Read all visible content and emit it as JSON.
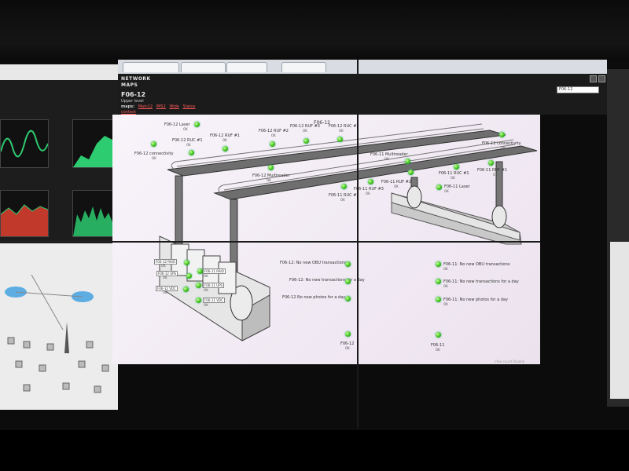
{
  "app": {
    "nav1": "NETWORK",
    "nav2": "MAPS",
    "title": "F06-12",
    "level": "Upper level",
    "maps_label": "maps:",
    "map_links": [
      "Main12",
      "IMS2",
      "Wide",
      "Status"
    ],
    "extra_link": "context",
    "search_value": "F06-12"
  },
  "map": {
    "header": "F06-12",
    "footer": "View count  Disable",
    "gantry_left": [
      {
        "label": "F06-12 Laser",
        "status": "OK"
      },
      {
        "label": "F06-12 RUC #1",
        "status": "OK"
      },
      {
        "label": "F06-12 RUF #1",
        "status": "OK"
      },
      {
        "label": "F06-12 RUF #2",
        "status": "OK"
      },
      {
        "label": "F06-12 RUF #3",
        "status": "OK"
      },
      {
        "label": "F06-12 RUC #2",
        "status": "OK"
      },
      {
        "label": "F06-12 connectivity",
        "status": "OK"
      },
      {
        "label": "F06-12 Multireader",
        "status": "OK"
      }
    ],
    "gantry_right": [
      {
        "label": "F06-11 connectivity",
        "status": "OK"
      },
      {
        "label": "F06-11 Multireader",
        "status": "OK"
      },
      {
        "label": "F06-11 RUF #1",
        "status": "OK"
      },
      {
        "label": "F06-11 RUC #1",
        "status": "OK"
      },
      {
        "label": "F06-11 RUF #2",
        "status": "OK"
      },
      {
        "label": "F06-11 RUF #3",
        "status": "OK"
      },
      {
        "label": "F06-11 RUC #2",
        "status": "OK"
      },
      {
        "label": "F06-11 Laser",
        "status": "OK"
      }
    ],
    "cabinet": [
      {
        "label": "F06-12 RAIO",
        "status": "OK"
      },
      {
        "label": "F06-12 UPS",
        "status": "OK"
      },
      {
        "label": "F06-11 RAIO",
        "status": "OK"
      },
      {
        "label": "F06-12 VDC",
        "status": "OK"
      },
      {
        "label": "F06-11 UPS",
        "status": "OK"
      },
      {
        "label": "F06-11 VDC",
        "status": "OK"
      }
    ],
    "checks_12": [
      {
        "label": "F06-12: No new OBU transactions"
      },
      {
        "label": "F06-12: No new transactions for a day"
      },
      {
        "label": "F06-12 No new photos for a day"
      }
    ],
    "checks_11": [
      {
        "label": "F06-11: No new OBU transactions",
        "status": "OK"
      },
      {
        "label": "F06-11: No new transactions for a day",
        "status": "OK"
      },
      {
        "label": "F06-11: No new photos for a day",
        "status": "OK"
      }
    ],
    "summary": [
      {
        "label": "F06-12",
        "status": "OK"
      },
      {
        "label": "F06-11",
        "status": "OK"
      }
    ]
  }
}
